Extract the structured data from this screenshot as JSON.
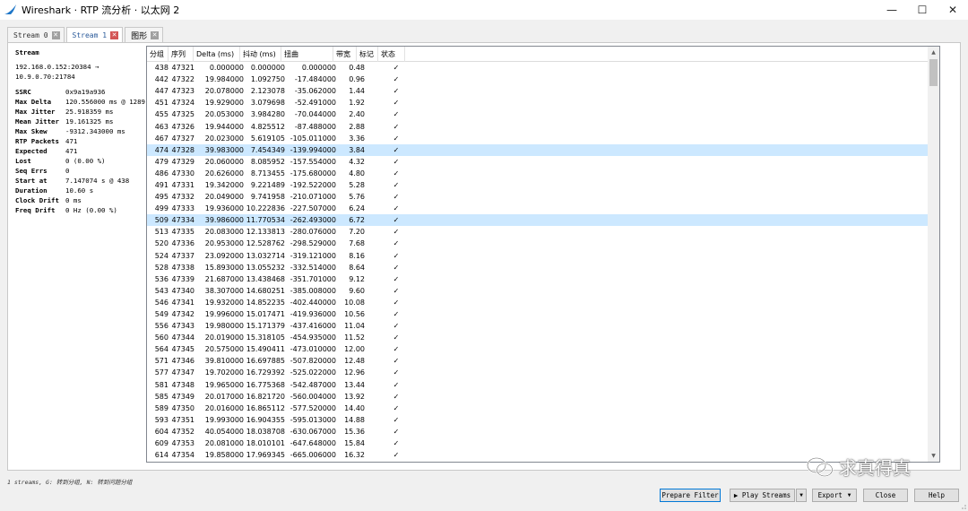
{
  "window": {
    "title": "Wireshark · RTP 流分析 · 以太网 2",
    "controls": {
      "minimize": "—",
      "maximize": "☐",
      "close": "✕"
    },
    "icon": "wireshark-fin-icon"
  },
  "tabs": [
    {
      "label": "Stream 0",
      "close": "✕",
      "active": false
    },
    {
      "label": "Stream 1",
      "close": "✕",
      "active": true
    },
    {
      "label": "图形",
      "close": "✕",
      "active": false
    }
  ],
  "info": {
    "title": "Stream",
    "stream_src": "192.168.0.152:20384 →",
    "stream_dst": "10.9.0.70:21784",
    "fields": [
      {
        "key": "SSRC",
        "value": "0x9a19a936"
      },
      {
        "key": "Max Delta",
        "value": "120.556000 ms @ 1289"
      },
      {
        "key": "Max Jitter",
        "value": "25.918359 ms"
      },
      {
        "key": "Mean Jitter",
        "value": "19.161325 ms"
      },
      {
        "key": "Max Skew",
        "value": "-9312.343000 ms"
      },
      {
        "key": "RTP Packets",
        "value": "471"
      },
      {
        "key": "Expected",
        "value": "471"
      },
      {
        "key": "Lost",
        "value": "0 (0.00 %)"
      },
      {
        "key": "Seq Errs",
        "value": "0"
      },
      {
        "key": "Start at",
        "value": "7.147074 s @ 438"
      },
      {
        "key": "Duration",
        "value": "10.60 s"
      },
      {
        "key": "Clock Drift",
        "value": "0 ms"
      },
      {
        "key": "Freq Drift",
        "value": "0 Hz (0.00 %)"
      }
    ]
  },
  "table": {
    "columns": [
      "分组",
      "序列",
      "Delta (ms)",
      "抖动 (ms)",
      "扭曲",
      "带宽",
      "标记",
      "状态"
    ],
    "sort_indicator": "^",
    "rows": [
      [
        "438",
        "47321",
        "0.000000",
        "0.000000",
        "0.000000",
        "0.48",
        "",
        "✓"
      ],
      [
        "442",
        "47322",
        "19.984000",
        "1.092750",
        "-17.484000",
        "0.96",
        "",
        "✓"
      ],
      [
        "447",
        "47323",
        "20.078000",
        "2.123078",
        "-35.062000",
        "1.44",
        "",
        "✓"
      ],
      [
        "451",
        "47324",
        "19.929000",
        "3.079698",
        "-52.491000",
        "1.92",
        "",
        "✓"
      ],
      [
        "455",
        "47325",
        "20.053000",
        "3.984280",
        "-70.044000",
        "2.40",
        "",
        "✓"
      ],
      [
        "463",
        "47326",
        "19.944000",
        "4.825512",
        "-87.488000",
        "2.88",
        "",
        "✓"
      ],
      [
        "467",
        "47327",
        "20.023000",
        "5.619105",
        "-105.011000",
        "3.36",
        "",
        "✓"
      ],
      [
        "474",
        "47328",
        "39.983000",
        "7.454349",
        "-139.994000",
        "3.84",
        "",
        "✓"
      ],
      [
        "479",
        "47329",
        "20.060000",
        "8.085952",
        "-157.554000",
        "4.32",
        "",
        "✓"
      ],
      [
        "486",
        "47330",
        "20.626000",
        "8.713455",
        "-175.680000",
        "4.80",
        "",
        "✓"
      ],
      [
        "491",
        "47331",
        "19.342000",
        "9.221489",
        "-192.522000",
        "5.28",
        "",
        "✓"
      ],
      [
        "495",
        "47332",
        "20.049000",
        "9.741958",
        "-210.071000",
        "5.76",
        "",
        "✓"
      ],
      [
        "499",
        "47333",
        "19.936000",
        "10.222836",
        "-227.507000",
        "6.24",
        "",
        "✓"
      ],
      [
        "509",
        "47334",
        "39.986000",
        "11.770534",
        "-262.493000",
        "6.72",
        "",
        "✓"
      ],
      [
        "513",
        "47335",
        "20.083000",
        "12.133813",
        "-280.076000",
        "7.20",
        "",
        "✓"
      ],
      [
        "520",
        "47336",
        "20.953000",
        "12.528762",
        "-298.529000",
        "7.68",
        "",
        "✓"
      ],
      [
        "524",
        "47337",
        "23.092000",
        "13.032714",
        "-319.121000",
        "8.16",
        "",
        "✓"
      ],
      [
        "528",
        "47338",
        "15.893000",
        "13.055232",
        "-332.514000",
        "8.64",
        "",
        "✓"
      ],
      [
        "536",
        "47339",
        "21.687000",
        "13.438468",
        "-351.701000",
        "9.12",
        "",
        "✓"
      ],
      [
        "543",
        "47340",
        "38.307000",
        "14.680251",
        "-385.008000",
        "9.60",
        "",
        "✓"
      ],
      [
        "546",
        "47341",
        "19.932000",
        "14.852235",
        "-402.440000",
        "10.08",
        "",
        "✓"
      ],
      [
        "549",
        "47342",
        "19.996000",
        "15.017471",
        "-419.936000",
        "10.56",
        "",
        "✓"
      ],
      [
        "556",
        "47343",
        "19.980000",
        "15.171379",
        "-437.416000",
        "11.04",
        "",
        "✓"
      ],
      [
        "560",
        "47344",
        "20.019000",
        "15.318105",
        "-454.935000",
        "11.52",
        "",
        "✓"
      ],
      [
        "564",
        "47345",
        "20.575000",
        "15.490411",
        "-473.010000",
        "12.00",
        "",
        "✓"
      ],
      [
        "571",
        "47346",
        "39.810000",
        "16.697885",
        "-507.820000",
        "12.48",
        "",
        "✓"
      ],
      [
        "577",
        "47347",
        "19.702000",
        "16.729392",
        "-525.022000",
        "12.96",
        "",
        "✓"
      ],
      [
        "581",
        "47348",
        "19.965000",
        "16.775368",
        "-542.487000",
        "13.44",
        "",
        "✓"
      ],
      [
        "585",
        "47349",
        "20.017000",
        "16.821720",
        "-560.004000",
        "13.92",
        "",
        "✓"
      ],
      [
        "589",
        "47350",
        "20.016000",
        "16.865112",
        "-577.520000",
        "14.40",
        "",
        "✓"
      ],
      [
        "593",
        "47351",
        "19.993000",
        "16.904355",
        "-595.013000",
        "14.88",
        "",
        "✓"
      ],
      [
        "604",
        "47352",
        "40.054000",
        "18.038708",
        "-630.067000",
        "15.36",
        "",
        "✓"
      ],
      [
        "609",
        "47353",
        "20.081000",
        "18.010101",
        "-647.648000",
        "15.84",
        "",
        "✓"
      ],
      [
        "614",
        "47354",
        "19.858000",
        "17.969345",
        "-665.006000",
        "16.32",
        "",
        "✓"
      ]
    ],
    "selected_rows": [
      7,
      13
    ]
  },
  "status_bar": "1 streams, G: 转到分组, N: 转到问题分组",
  "watermark": "求真得真",
  "buttons": {
    "prepare_filter": "Prepare Filter",
    "play_streams": "▶ Play Streams",
    "export": "Export",
    "close": "Close",
    "help": "Help",
    "dropdown": "▼"
  }
}
